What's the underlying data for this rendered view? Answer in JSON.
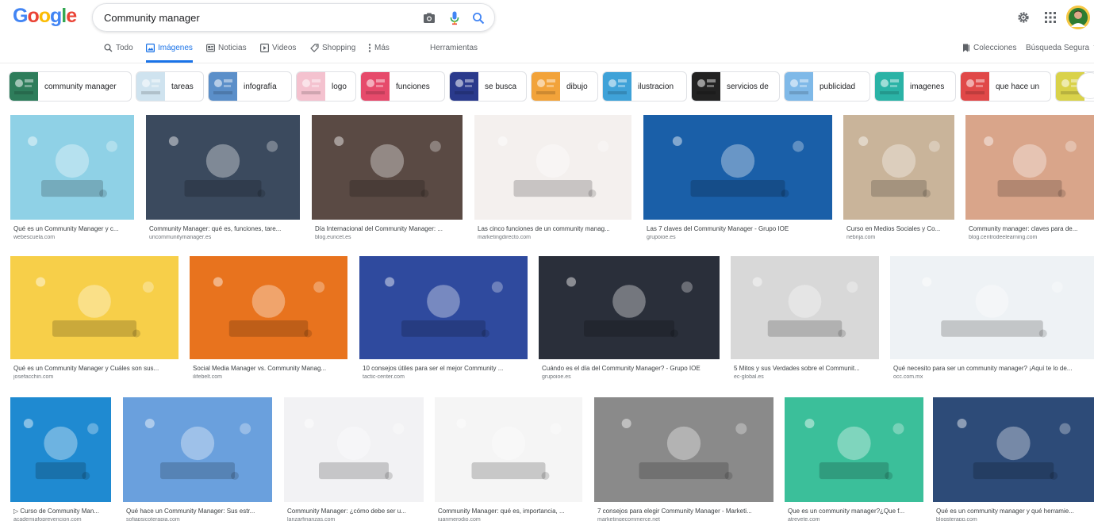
{
  "search": {
    "query": "Community manager"
  },
  "logo": {
    "letters": [
      "G",
      "o",
      "o",
      "g",
      "l",
      "e"
    ],
    "colors": [
      "#4285F4",
      "#EA4335",
      "#FBBC05",
      "#4285F4",
      "#34A853",
      "#EA4335"
    ]
  },
  "tabs": [
    {
      "label": "Todo",
      "icon": "search-icon"
    },
    {
      "label": "Imágenes",
      "icon": "image-icon",
      "active": true
    },
    {
      "label": "Noticias",
      "icon": "news-icon"
    },
    {
      "label": "Videos",
      "icon": "play-icon"
    },
    {
      "label": "Shopping",
      "icon": "tag-icon"
    },
    {
      "label": "Más",
      "icon": "more-vert-icon"
    },
    {
      "label": "Herramientas",
      "icon": ""
    }
  ],
  "tabs_right": {
    "collections": "Colecciones",
    "safe_search": "Búsqueda Segura"
  },
  "chips": [
    {
      "label": "community manager",
      "color": "#2e7d5b"
    },
    {
      "label": "tareas",
      "color": "#cfe3ef"
    },
    {
      "label": "infografía",
      "color": "#5b8fc9"
    },
    {
      "label": "logo",
      "color": "#f4c2cf"
    },
    {
      "label": "funciones",
      "color": "#e64a6b"
    },
    {
      "label": "se busca",
      "color": "#2a3a8c"
    },
    {
      "label": "dibujo",
      "color": "#f2a33a"
    },
    {
      "label": "ilustracion",
      "color": "#3fa2d8"
    },
    {
      "label": "servicios de",
      "color": "#222222"
    },
    {
      "label": "publicidad",
      "color": "#7fb9e8"
    },
    {
      "label": "imagenes",
      "color": "#2bb3a6"
    },
    {
      "label": "que hace un",
      "color": "#e04848"
    },
    {
      "label": "",
      "color": "#d9d24a"
    }
  ],
  "images": [
    {
      "title": "Qué es un Community Manager y c...",
      "source": "webescuela.com",
      "color": "#8fd1e6"
    },
    {
      "title": "Community Manager: qué es, funciones, tare...",
      "source": "uncommunitymanager.es",
      "color": "#3b4a5e"
    },
    {
      "title": "Día Internacional del Community Manager: ...",
      "source": "blog.euncet.es",
      "color": "#5a4a44"
    },
    {
      "title": "Las cinco funciones de un community manag...",
      "source": "marketingdirecto.com",
      "color": "#f4f0ee"
    },
    {
      "title": "Las 7 claves del Community Manager - Grupo IOE",
      "source": "grupoioe.es",
      "color": "#1a5fa8"
    },
    {
      "title": "Curso en Medios Sociales y Co...",
      "source": "nebrija.com",
      "color": "#c9b49a"
    },
    {
      "title": "Community manager: claves para de...",
      "source": "blog.centrodeelearning.com",
      "color": "#d9a58a"
    },
    {
      "title": "Qué es un Community Manager y Cuáles son sus...",
      "source": "josefacchin.com",
      "color": "#f7cf49"
    },
    {
      "title": "Social Media Manager vs. Community Manag...",
      "source": "ilifebelt.com",
      "color": "#e8731e"
    },
    {
      "title": "10 consejos útiles para ser el mejor Community ...",
      "source": "tactic-center.com",
      "color": "#2f4a9e"
    },
    {
      "title": "Cuándo es el día del Community Manager? - Grupo IOE",
      "source": "grupoioe.es",
      "color": "#2a2f3a"
    },
    {
      "title": "5 Mitos y sus Verdades sobre el Communit...",
      "source": "ec-global.es",
      "color": "#d8d8d8"
    },
    {
      "title": "Qué necesito para ser un community manager? ¡Aquí te lo de...",
      "source": "occ.com.mx",
      "color": "#eef2f5"
    },
    {
      "title": "▷ Curso de Community Man...",
      "source": "academiafoprevencion.com",
      "color": "#1f8ad1"
    },
    {
      "title": "Qué hace un Community Manager: Sus estr...",
      "source": "sofiapsicoterapia.com",
      "color": "#6aa0dd"
    },
    {
      "title": "Community Manager: ¿cómo debe ser u...",
      "source": "lanzarfinanzas.com",
      "color": "#f2f2f4"
    },
    {
      "title": "Community Manager: qué es, importancia, ...",
      "source": "juanmerodio.com",
      "color": "#f5f5f5"
    },
    {
      "title": "7 consejos para elegir Community Manager - Marketi...",
      "source": "marketingecommerce.net",
      "color": "#8a8a8a"
    },
    {
      "title": "Que es un community manager?¿Que f...",
      "source": "atrevete.com",
      "color": "#3bbf9a"
    },
    {
      "title": "Qué es un community manager y qué herramie...",
      "source": "blogsterapp.com",
      "color": "#2d4b78"
    }
  ]
}
